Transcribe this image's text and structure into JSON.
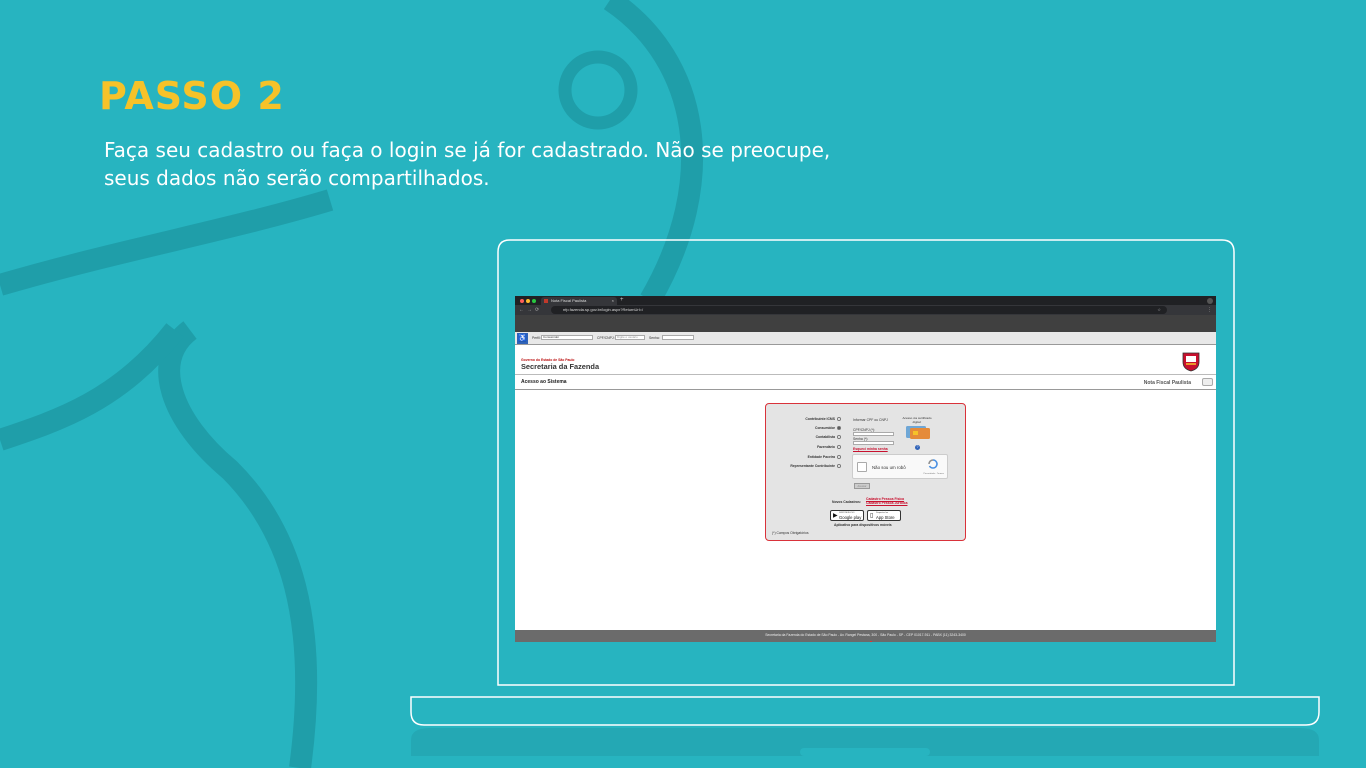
{
  "slide": {
    "title": "PASSO 2",
    "subtitle": "Faça seu cadastro ou faça o login se já for cadastrado. Não se preocupe, seus dados não serão compartilhados."
  },
  "colors": {
    "background": "#27b4c0",
    "title": "#f6c229",
    "accent_red": "#c8102e"
  },
  "browser": {
    "tab_title": "Nota Fiscal Paulista",
    "tab_close": "×",
    "new_tab": "+",
    "url": "nfp.fazenda.sp.gov.br/login.aspx?ReturnUrl=/"
  },
  "site": {
    "toolbar": {
      "perfil_label": "Perfil:",
      "perfil_value": "Consumidor",
      "cpf_label": "CPF/CNPJ:",
      "cpf_placeholder": "Digite o usuário",
      "senha_label": "Senha:"
    },
    "header": {
      "gov": "Governo do Estado de São Paulo",
      "secretaria": "Secretaria da Fazenda"
    },
    "page_title": "Acesso ao Sistema",
    "product_title": "Nota Fiscal Paulista",
    "login": {
      "roles": [
        "Contribuinte ICMS",
        "Consumidor",
        "Contabilista",
        "Fazendário",
        "Entidade Paceira",
        "Representante Contribuinte"
      ],
      "informar": "Informar CPF ou CNPJ",
      "cert_label": "Acesso via certificado digital:",
      "cpf_field_label": "CPF/CNPJ (*):",
      "senha_field_label": "Senha (*):",
      "esqueci": "Esqueci minha senha",
      "captcha_text": "Não sou um robô",
      "captcha_brand": "reCAPTCHA",
      "captcha_terms": "Privacidade - Termos",
      "entrar": "Acessar",
      "novos_cadastros": "Novos Cadastros:",
      "cadastro_pf": "Cadastro Pessoa Física",
      "cadastro_pj": "Cadastro Pessoa Jurídica",
      "google_small": "DISPONÍVEL NO",
      "google_big": "Google play",
      "apple_small": "Disponível na",
      "apple_big": "App Store",
      "apps_label": "Aplicativo para dispositivos móveis",
      "obrigatorios": "(*) Campos Obrigatórios"
    },
    "footer": "Secretaria da Fazenda do Estado de São Paulo - Av. Rangel Pestana, 300 - São Paulo - SP - CEP 01017-911 - PABX (11) 3243-3400"
  }
}
